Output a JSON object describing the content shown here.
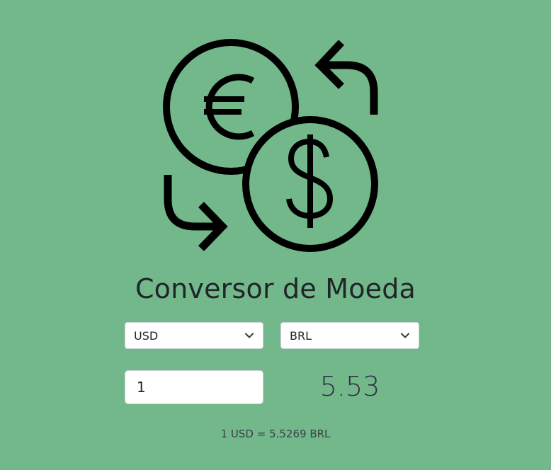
{
  "app": {
    "title": "Conversor de Moeda"
  },
  "logo": {
    "icon": "currency-exchange-icon",
    "euro_symbol": "€",
    "dollar_symbol": "$"
  },
  "from_currency": {
    "selected": "USD"
  },
  "to_currency": {
    "selected": "BRL"
  },
  "amount": {
    "value": "1"
  },
  "result": {
    "value": "5.53"
  },
  "rate_info": {
    "text": "1 USD = 5.5269 BRL"
  },
  "colors": {
    "background": "#72b88a",
    "icon": "#000000",
    "text": "#212529"
  }
}
